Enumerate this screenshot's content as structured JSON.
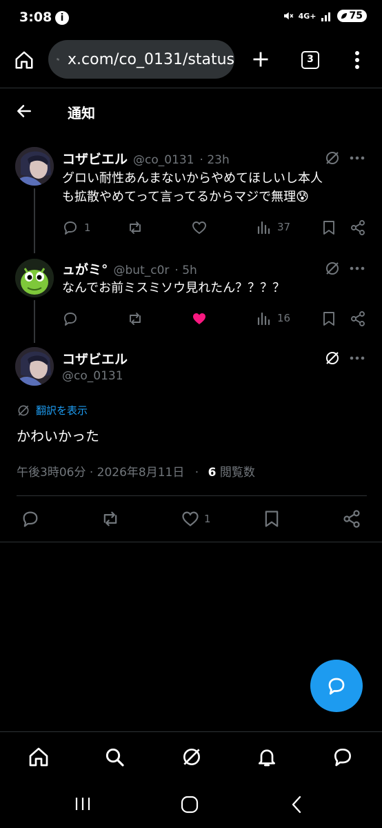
{
  "status_bar": {
    "time": "3:08",
    "info_glyph": "i",
    "network": "4G+",
    "battery": "75"
  },
  "browser": {
    "url": "x.com/co_0131/status",
    "tab_count": "3"
  },
  "header": {
    "title": "通知"
  },
  "thread": [
    {
      "name": "コザビエル",
      "handle": "@co_0131",
      "time": "· 23h",
      "text_lines": [
        "グロい耐性あんまないからやめてほしいし本人",
        "も拡散やめてって言ってるからマジで無理"
      ],
      "emoji": "😰",
      "replies": "1",
      "reposts": "",
      "likes": "",
      "views": "37",
      "liked": false
    },
    {
      "name": "ュがミ°",
      "handle": "@but_c0r",
      "time": "· 5h",
      "text_lines": [
        "なんでお前ミスミソウ見れたん？？？？"
      ],
      "replies": "",
      "reposts": "",
      "likes": "",
      "views": "16",
      "liked": true
    }
  ],
  "main_post": {
    "name": "コザビエル",
    "handle": "@co_0131",
    "translate_label": "翻訳を表示",
    "text": "かわいかった",
    "timestamp": "午後3時06分 · 2026年8月11日",
    "dot": "·",
    "views_count": "6",
    "views_label": "閲覧数",
    "likes": "1"
  },
  "colors": {
    "accent": "#1d9bf0",
    "like_pink": "#f91880",
    "muted": "#71767b",
    "background": "#000000"
  }
}
